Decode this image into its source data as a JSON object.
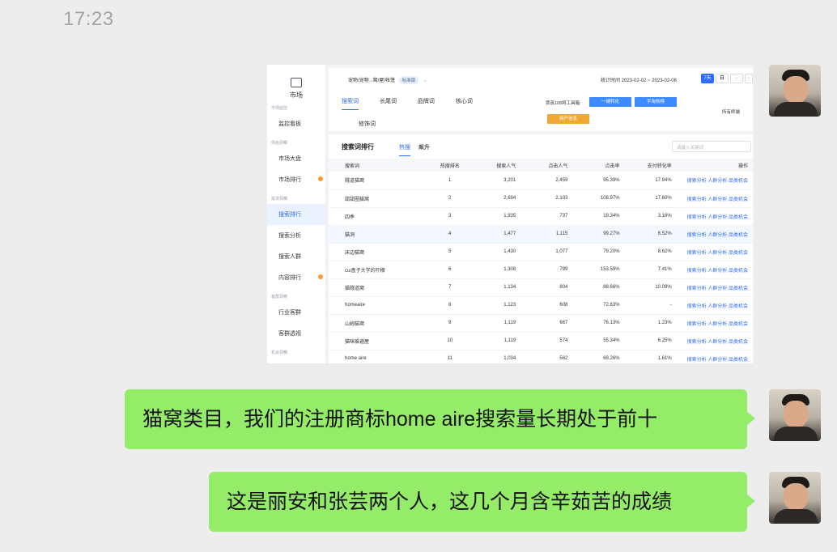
{
  "chat": {
    "time": "17:23",
    "messages": [
      {
        "text": "猫窝类目，我们的注册商标home aire搜索量长期处于前十"
      },
      {
        "text": "这是丽安和张芸两个人，这几个月含辛茹苦的成绩"
      }
    ]
  },
  "screenshot": {
    "sidebar": {
      "logo_label": "市场",
      "items": [
        {
          "group": "市场监控"
        },
        {
          "label": "监控看板"
        },
        {
          "group": "供给洞察"
        },
        {
          "label": "市场大盘"
        },
        {
          "label": "市场排行"
        },
        {
          "group": "需求洞察"
        },
        {
          "label": "搜索排行"
        },
        {
          "label": "搜索分析"
        },
        {
          "label": "搜索人群"
        },
        {
          "label": "内容排行"
        },
        {
          "group": "客群洞察"
        },
        {
          "label": "行业客群"
        },
        {
          "label": "客群透视"
        },
        {
          "group": "机会洞察"
        }
      ]
    },
    "top": {
      "breadcrumb": "宠物/宠物...窝/屋/帐篷",
      "edition_badge": "标准版",
      "stat_time": "统计时间 2023-02-02 ~ 2023-02-08",
      "range_7d": "7天",
      "range_day": "日",
      "tabs": [
        "搜索词",
        "长尾词",
        "品牌词",
        "核心词"
      ],
      "tab_extra": "修饰词",
      "toolbox_label": "贾真108将工具箱:",
      "btn_one_click": "一键转化",
      "btn_hot": "手淘热榜",
      "btn_user": "用户信息",
      "terminal": "所有终端"
    },
    "panel": {
      "title": "搜索词排行",
      "tab_hot": "热搜",
      "tab_rise": "飙升",
      "search_placeholder": "请输入关键词",
      "columns": [
        "搜索词",
        "热搜排名",
        "搜索人气",
        "点击人气",
        "点击率",
        "支付转化率",
        "操作"
      ],
      "action_text": "搜索分析 人群分析 品类机会",
      "rows": [
        {
          "term": "隧道猫窝",
          "rank": "1",
          "search": "3,201",
          "click": "2,459",
          "ctr": "95.39%",
          "cvr": "17.94%"
        },
        {
          "term": "甜甜圈猫窝",
          "rank": "2",
          "search": "2,694",
          "click": "2,103",
          "ctr": "108.97%",
          "cvr": "17.60%"
        },
        {
          "term": "四季",
          "rank": "3",
          "search": "1,935",
          "click": "737",
          "ctr": "19.34%",
          "cvr": "3.16%"
        },
        {
          "term": "猫洞",
          "rank": "4",
          "search": "1,477",
          "click": "1,115",
          "ctr": "99.27%",
          "cvr": "6.52%"
        },
        {
          "term": "床边猫窝",
          "rank": "5",
          "search": "1,430",
          "click": "1,077",
          "ctr": "79.20%",
          "cvr": "8.62%"
        },
        {
          "term": "cui盒子大学的柠檬",
          "rank": "6",
          "search": "1,308",
          "click": "799",
          "ctr": "153.59%",
          "cvr": "7.41%"
        },
        {
          "term": "猫隧道窝",
          "rank": "7",
          "search": "1,134",
          "click": "804",
          "ctr": "88.66%",
          "cvr": "10.09%"
        },
        {
          "term": "homeaire",
          "rank": "8",
          "search": "1,123",
          "click": "608",
          "ctr": "72.63%",
          "cvr": "-"
        },
        {
          "term": "山姆猫窝",
          "rank": "9",
          "search": "1,119",
          "click": "667",
          "ctr": "76.13%",
          "cvr": "1.23%"
        },
        {
          "term": "猫咪躲避屋",
          "rank": "10",
          "search": "1,119",
          "click": "574",
          "ctr": "55.34%",
          "cvr": "6.25%"
        },
        {
          "term": "home aire",
          "rank": "11",
          "search": "1,034",
          "click": "562",
          "ctr": "69.26%",
          "cvr": "1.61%"
        }
      ]
    }
  }
}
